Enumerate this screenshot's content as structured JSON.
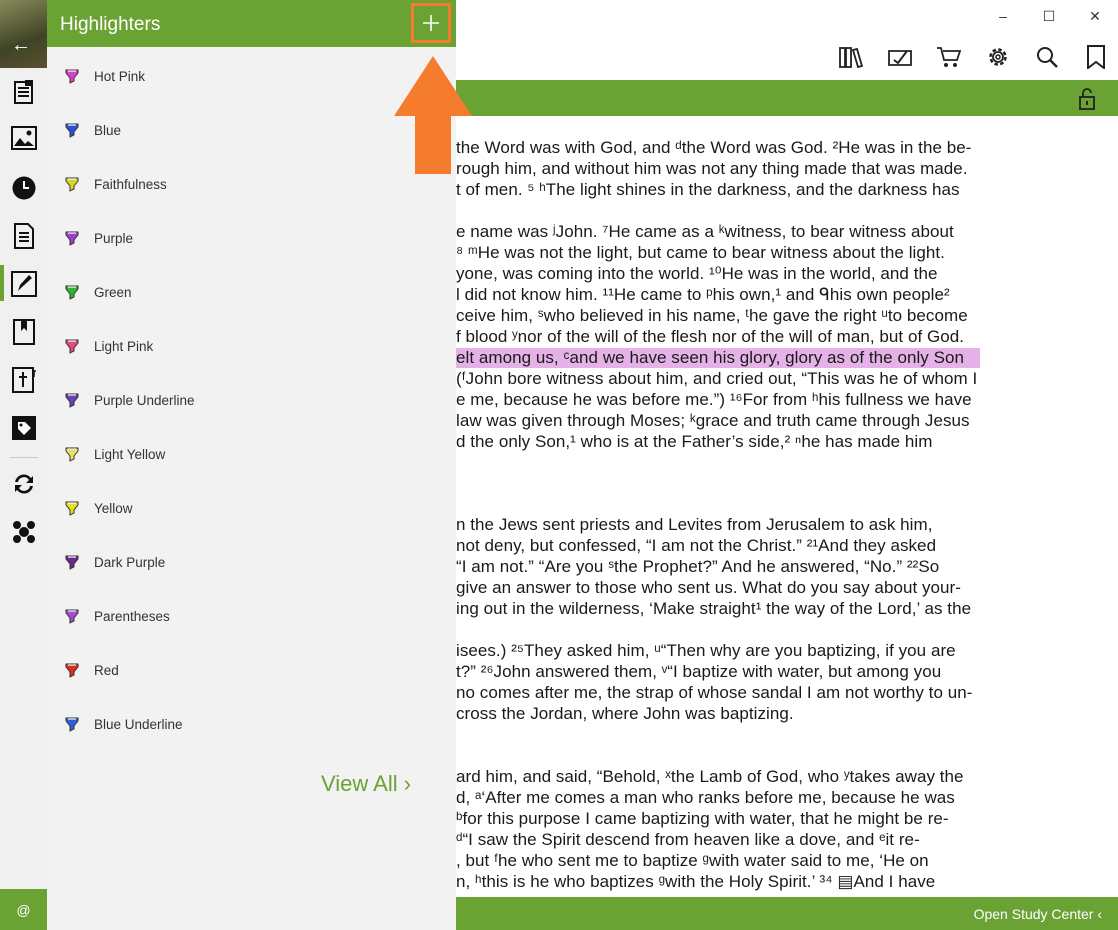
{
  "window": {
    "minimize": "–",
    "maximize": "☐",
    "close": "✕"
  },
  "toolbar": {
    "icons": [
      "library-icon",
      "reading-plan-icon",
      "store-cart-icon",
      "settings-gear-icon",
      "search-icon",
      "bookmark-icon"
    ]
  },
  "rail": {
    "back_label": "←",
    "items": [
      "notes-icon",
      "images-icon",
      "history-icon",
      "document-icon",
      "highlighter-icon",
      "bookmark-book-icon",
      "bible-icon",
      "tag-icon",
      "sync-icon",
      "community-icon"
    ],
    "bottom_label": "@"
  },
  "panel": {
    "title": "Highlighters",
    "add_label": "+",
    "highlighters": [
      {
        "label": "Hot Pink",
        "color": "#e040c8"
      },
      {
        "label": "Blue",
        "color": "#2a4fd8"
      },
      {
        "label": "Faithfulness",
        "color": "#d8d820"
      },
      {
        "label": "Purple",
        "color": "#9b3fd0"
      },
      {
        "label": "Green",
        "color": "#2fb52f"
      },
      {
        "label": "Light Pink",
        "color": "#e04a7a"
      },
      {
        "label": "Purple Underline",
        "color": "#6b3fb0"
      },
      {
        "label": "Light Yellow",
        "color": "#e6e060"
      },
      {
        "label": "Yellow",
        "color": "#e8e020"
      },
      {
        "label": "Dark Purple",
        "color": "#6a2a8a"
      },
      {
        "label": "Parentheses",
        "color": "#a04ad0"
      },
      {
        "label": "Red",
        "color": "#d83020"
      },
      {
        "label": "Blue Underline",
        "color": "#3060d8"
      }
    ],
    "view_all": "View All ›"
  },
  "bible_lines": [
    {
      "text": "the Word was with God, and ᵈthe Word was God. ²He was in the be-"
    },
    {
      "text": "rough him, and without him was not any thing made that was made."
    },
    {
      "text": "t of men. ⁵ ʰThe light shines in the darkness, and the darkness has"
    },
    {
      "text": "e name was ʲJohn. ⁷He came as a ᵏwitness, to bear witness about"
    },
    {
      "text": "⁸ ᵐHe was not the light, but came to bear witness about the light."
    },
    {
      "text": "yone, was coming into the world. ¹⁰He was in the world, and the"
    },
    {
      "text": "l did not know him. ¹¹He came to ᵖhis own,¹ and ᑫhis own people²"
    },
    {
      "text": "ceive him, ˢwho believed in his name, ᵗhe gave the right ᵘto become"
    },
    {
      "text": "f blood ʸnor of the will of the flesh nor of the will of man, but of God."
    },
    {
      "text": "elt among us, ᶜand we have seen his glory, glory as of the only Son"
    },
    {
      "text": "(ᶠJohn bore witness about him, and cried out, “This was he of whom I"
    },
    {
      "text": "e me, because he was before me.”) ¹⁶For from ʰhis fullness we have"
    },
    {
      "text": "law was given through Moses; ᵏgrace and truth came through Jesus"
    },
    {
      "text": "d the only Son,¹ who is at the Father’s side,² ⁿhe has made him"
    },
    {
      "text": "n the Jews sent priests and Levites from Jerusalem to ask him,"
    },
    {
      "text": "not deny, but confessed, “I am not the Christ.” ²¹And they asked"
    },
    {
      "text": "“I am not.” “Are you ˢthe Prophet?” And he answered, “No.” ²²So"
    },
    {
      "text": "give an answer to those who sent us. What do you say about your-"
    },
    {
      "text": "ing out in the wilderness, ‘Make straight¹ the way of the Lord,’ as the"
    },
    {
      "text": "isees.) ²⁵They asked him, ᵘ“Then why are you baptizing, if you are"
    },
    {
      "text": "t?” ²⁶John answered them, ᵛ“I baptize with water, but among you"
    },
    {
      "text": "no comes after me, the strap of whose sandal I am not worthy to un-"
    },
    {
      "text": "cross the Jordan, where John was baptizing."
    },
    {
      "text": "ard him, and said, “Behold, ˣthe Lamb of God, who ʸtakes away the"
    },
    {
      "text": "d, ᵃ‘After me comes a man who ranks before me, because he was"
    },
    {
      "text": "ᵇfor this purpose I came baptizing with water, that he might be re-"
    },
    {
      "text": "ᵈ“I saw the Spirit descend from heaven like a dove, and ᵉit re-"
    },
    {
      "text": ", but ᶠhe who sent me to baptize ᵍwith water said to me, ‘He on"
    },
    {
      "text": "n, ʰthis is he who baptizes ᵍwith the Holy Spirit.’ ³⁴ ▤And I have"
    }
  ],
  "bottom": {
    "study_center": "Open Study Center  ‹"
  }
}
